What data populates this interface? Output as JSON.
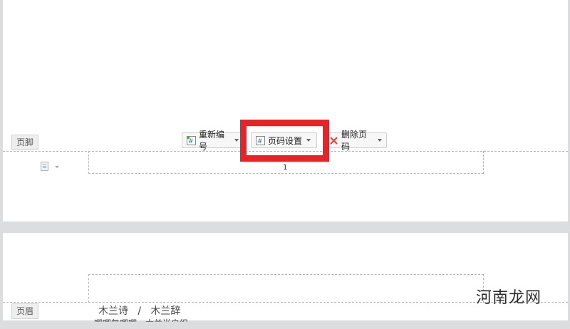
{
  "page1": {
    "footer_tag": "页脚",
    "toolbar": {
      "renumber_label": "重新编号",
      "page_number_settings_label": "页码设置",
      "delete_page_number_label": "删除页码"
    },
    "page_number": "1"
  },
  "page2": {
    "header_tag": "页眉",
    "body_line1": "木兰诗   /   木兰辞",
    "body_line2_partial": "唧唧复唧唧，木兰当户织"
  },
  "watermark": "河南龙网",
  "colors": {
    "highlight": "#e5232b",
    "delete_icon": "#d9453a"
  }
}
